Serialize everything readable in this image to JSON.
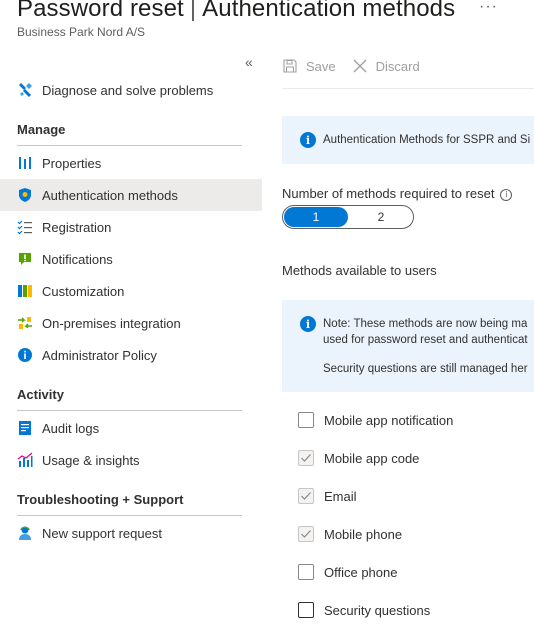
{
  "header": {
    "title": "Password reset",
    "separator": "|",
    "section": "Authentication methods",
    "subtitle": "Business Park Nord A/S",
    "more_label": "···"
  },
  "sidebar": {
    "collapse_label": "«",
    "top_items": [
      {
        "label": "Diagnose and solve problems",
        "icon": "wrench-tool-icon"
      }
    ],
    "sections": [
      {
        "title": "Manage",
        "items": [
          {
            "label": "Properties",
            "icon": "properties-icon"
          },
          {
            "label": "Authentication methods",
            "icon": "shield-icon",
            "selected": true
          },
          {
            "label": "Registration",
            "icon": "checklist-icon"
          },
          {
            "label": "Notifications",
            "icon": "notification-icon"
          },
          {
            "label": "Customization",
            "icon": "palette-icon"
          },
          {
            "label": "On-premises integration",
            "icon": "sync-icon"
          },
          {
            "label": "Administrator Policy",
            "icon": "info-icon"
          }
        ]
      },
      {
        "title": "Activity",
        "items": [
          {
            "label": "Audit logs",
            "icon": "audit-log-icon"
          },
          {
            "label": "Usage & insights",
            "icon": "usage-chart-icon"
          }
        ]
      },
      {
        "title": "Troubleshooting + Support",
        "items": [
          {
            "label": "New support request",
            "icon": "support-person-icon"
          }
        ]
      }
    ]
  },
  "toolbar": {
    "save_label": "Save",
    "discard_label": "Discard"
  },
  "main": {
    "info_banner_text": "Authentication Methods for SSPR and Si",
    "methods_required_label": "Number of methods required to reset",
    "methods_required_options": [
      "1",
      "2"
    ],
    "methods_required_selected": "1",
    "methods_available_label": "Methods available to users",
    "note_line1": "Note: These methods are now being ma",
    "note_line2": "used for password reset and authenticat",
    "note_line3": "Security questions are still managed her",
    "methods": [
      {
        "label": "Mobile app notification",
        "checked": false
      },
      {
        "label": "Mobile app code",
        "checked": true
      },
      {
        "label": "Email",
        "checked": true
      },
      {
        "label": "Mobile phone",
        "checked": true
      },
      {
        "label": "Office phone",
        "checked": false
      },
      {
        "label": "Security questions",
        "checked": false
      }
    ]
  },
  "colors": {
    "accent": "#0078d4",
    "selected_bg": "#edebe9",
    "banner_bg": "#ebf3fc"
  }
}
